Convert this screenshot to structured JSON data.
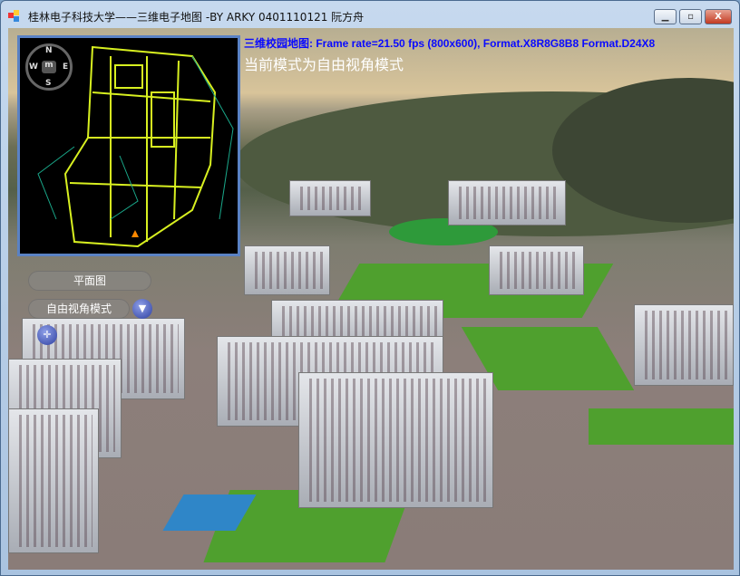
{
  "window": {
    "title": "桂林电子科技大学——三维电子地图  -BY ARKY 0401110121 阮方舟",
    "minimize": "▁",
    "maximize": "▫",
    "close": "X"
  },
  "overlay": {
    "frame_info": "三维校园地图: Frame rate=21.50 fps (800x600), Format.X8R8G8B8 Format.D24X8",
    "mode_text": "当前模式为自由视角模式"
  },
  "minimap": {
    "compass": {
      "n": "N",
      "s": "S",
      "e": "E",
      "w": "W",
      "center": "m"
    }
  },
  "controls": {
    "plan_view": "平面图",
    "free_view": "自由视角模式",
    "dropdown_icon": "▼",
    "move_icon": "✛"
  },
  "colors": {
    "frame_info": "#0a0aff",
    "minimap_border": "#5a82c4",
    "map_lines": "#d8f020"
  }
}
